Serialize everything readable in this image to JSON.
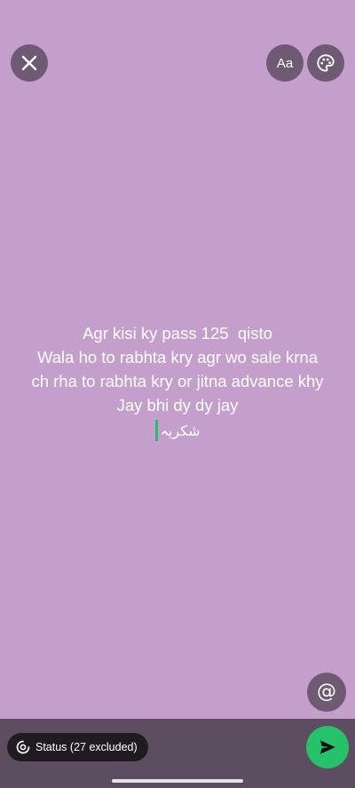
{
  "toolbar": {
    "close_icon": "close-icon",
    "font_label": "Aa",
    "palette_icon": "palette-icon"
  },
  "status": {
    "lines": [
      "Agr kisi ky pass 125  qisto",
      "Wala ho to rabhta kry agr wo sale krna",
      "ch rha to rabhta kry or jitna advance khy",
      "Jay bhi dy dy jay"
    ],
    "urdu": "شکریہ"
  },
  "mention": {
    "label": "@"
  },
  "footer": {
    "audience_label": "Status (27 excluded)",
    "send_icon": "send-icon"
  },
  "colors": {
    "background": "#c59fcc",
    "bar": "#5c4d61",
    "accent": "#25c26a"
  }
}
